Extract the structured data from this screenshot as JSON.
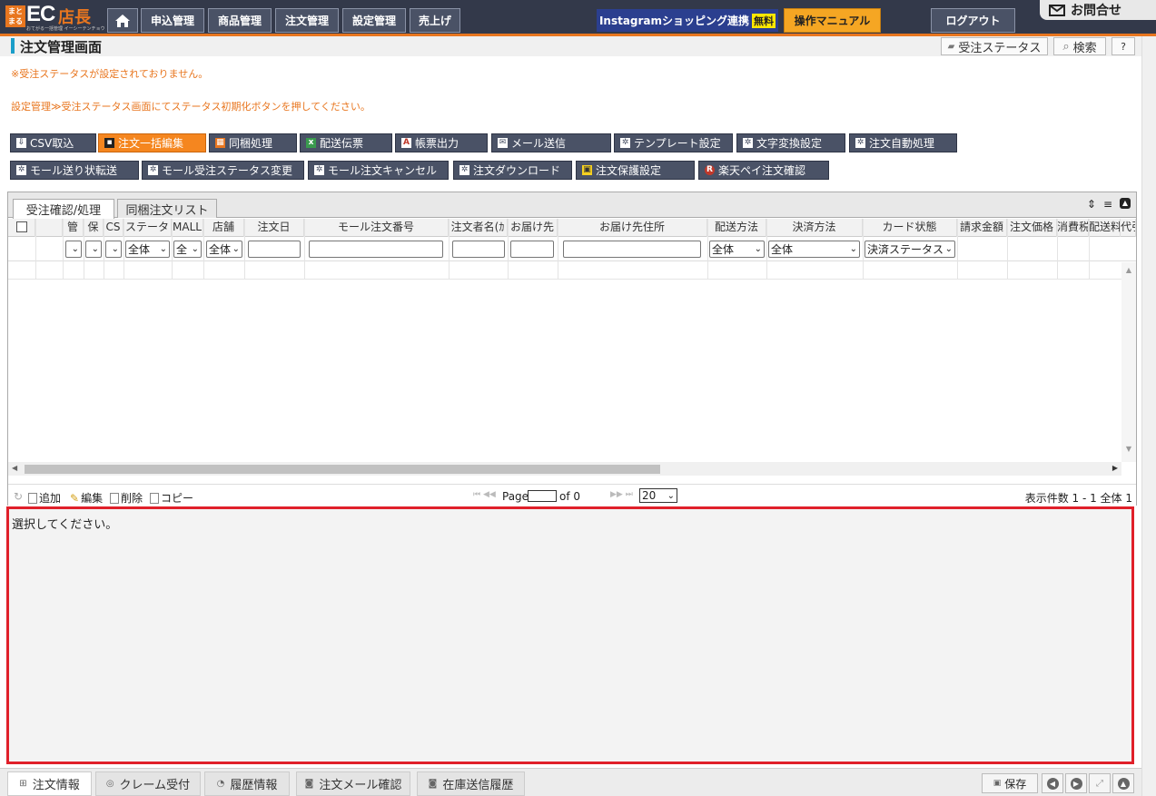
{
  "brand": {
    "badge_top": "まと",
    "badge_bottom": "まる",
    "ec": "EC",
    "store": "店長",
    "sub": "おてがる一括管理 イーシーテンチョウ"
  },
  "nav": [
    "申込管理",
    "商品管理",
    "注文管理",
    "設定管理",
    "売上げ"
  ],
  "instagram": {
    "label": "Instagramショッピング連携",
    "free": "無料"
  },
  "manual": "操作マニュアル",
  "logout": "ログアウト",
  "contact": "お問合せ",
  "page_title": "注文管理画面",
  "title_buttons": {
    "status": "受注ステータス",
    "search": "検索",
    "help": "?"
  },
  "notice": {
    "line1": "※受注ステータスが設定されておりません。",
    "line2": "設定管理≫受注ステータス画面にてステータス初期化ボタンを押してください。"
  },
  "actions_row1": [
    "CSV取込",
    "注文一括編集",
    "同梱処理",
    "配送伝票",
    "帳票出力",
    "メール送信",
    "テンプレート設定",
    "文字変換設定",
    "注文自動処理"
  ],
  "actions_row2": [
    "モール送り状転送",
    "モール受注ステータス変更",
    "モール注文キャンセル",
    "注文ダウンロード",
    "注文保護設定",
    "楽天ペイ注文確認"
  ],
  "grid_tabs": [
    "受注確認/処理",
    "同梱注文リスト"
  ],
  "columns": [
    "",
    "管",
    "保",
    "CS",
    "ステータ",
    "MALL",
    "店舗",
    "注文日",
    "モール注文番号",
    "注文者名(ｶ",
    "お届け先",
    "お届け先住所",
    "配送方法",
    "決済方法",
    "カード状態",
    "請求金額",
    "注文価格",
    "消費税",
    "配送料",
    "代引"
  ],
  "filters": {
    "status": "全体",
    "mall": "全",
    "store": "全体",
    "delivery": "全体",
    "payment": "全体",
    "card": "決済ステータス"
  },
  "pager": {
    "refresh": "↻",
    "add": "追加",
    "edit": "編集",
    "delete": "削除",
    "copy": "コピー",
    "page": "Page",
    "page_value": "",
    "of": "of 0",
    "per_page": "20",
    "count": "表示件数 1 - 1 全体 1"
  },
  "detail_text": "選択してください。",
  "bottom_tabs": [
    "注文情報",
    "クレーム受付",
    "履歴情報",
    "注文メール確認",
    "在庫送信履歴"
  ],
  "bottom_right": {
    "save": "保存"
  },
  "colors": {
    "accent": "#e8761f",
    "nav_bg": "#33394a",
    "button_bg": "#4a5266",
    "highlight_border": "#e0202a"
  }
}
